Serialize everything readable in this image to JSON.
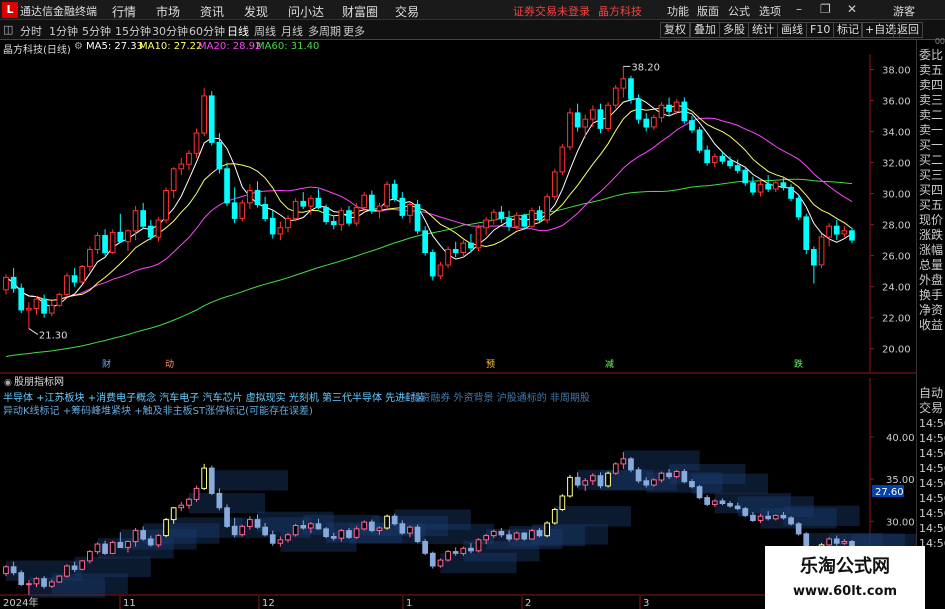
{
  "menubar": {
    "logo": "L",
    "app_title": "通达信金融终端",
    "items": [
      "行情",
      "市场",
      "资讯",
      "发现",
      "问小达",
      "财富圈",
      "交易"
    ],
    "notice": "证券交易未登录",
    "notice_stock": "晶方科技",
    "right_items": [
      "功能",
      "版面",
      "公式",
      "选项"
    ],
    "guest": "游客"
  },
  "toolbar": {
    "periods": [
      "分时",
      "1分钟",
      "5分钟",
      "15分钟",
      "30分钟",
      "60分钟",
      "日线",
      "周线",
      "月线",
      "多周期",
      "更多"
    ],
    "active_period": "日线",
    "right_buttons": [
      "复权",
      "叠加",
      "多股",
      "统计",
      "画线",
      "F10",
      "标记",
      "+自选",
      "返回"
    ]
  },
  "info": {
    "stock": "晶方科技(日线)",
    "ma5_label": "MA5: 27.33",
    "ma10_label": "MA10: 27.22",
    "ma20_label": "MA20: 28.92",
    "ma60_label": "MA60: 31.40",
    "colors": {
      "ma5": "#ffffff",
      "ma10": "#ffff66",
      "ma20": "#ff44ff",
      "ma60": "#44dd44"
    }
  },
  "indicator": {
    "title": "股朋指标网",
    "concept_line": "半导体 +江苏板块 +消费电子概念 汽车电子 汽车芯片 虚拟现实 光刻机 第三代半导体 先进封装",
    "concept_line_dim": "+融资融券 外资背景 沪股通标的 非周期股",
    "note_line": "异动K线标记 +筹码峰堆紧块 +触及非主板ST涨停标记(可能存在误差)"
  },
  "sidebar": {
    "items": [
      "委比",
      "卖五",
      "卖四",
      "卖三",
      "卖二",
      "卖一",
      "买一",
      "买二",
      "买三",
      "买四",
      "买五",
      "现价",
      "涨跌",
      "涨幅",
      "总量",
      "外盘",
      "换手",
      "净资",
      "收益"
    ],
    "lower_items": [
      "自动",
      "交易",
      "14:56",
      "14:56",
      "14:56",
      "14:56",
      "14:56",
      "14:56",
      "14:56",
      "14:56",
      "14:56"
    ],
    "top_tag": "00"
  },
  "watermark": {
    "line1": "乐淘公式网",
    "line2": "www.60lt.com"
  },
  "chart_data": [
    {
      "type": "candlestick",
      "title": "晶方科技(日线)",
      "ylim": [
        18.5,
        39.0
      ],
      "y_ticks": [
        20.0,
        22.0,
        24.0,
        26.0,
        28.0,
        30.0,
        32.0,
        34.0,
        36.0,
        38.0
      ],
      "x_labels": [
        "2024年",
        "11",
        "12",
        "1",
        "2",
        "3",
        "4"
      ],
      "annotations": {
        "high": "38.20",
        "low": "21.30"
      },
      "event_markers": [
        "财",
        "动",
        "预",
        "减",
        "跌"
      ],
      "up_color": "#ff3333",
      "down_color": "#00ffff",
      "grid": false,
      "candles": [
        [
          23.8,
          24.8,
          23.5,
          24.6
        ],
        [
          24.6,
          25.2,
          23.6,
          23.9
        ],
        [
          23.9,
          24.2,
          22.3,
          22.5
        ],
        [
          22.5,
          23.0,
          21.3,
          22.6
        ],
        [
          22.6,
          23.4,
          22.2,
          23.2
        ],
        [
          23.2,
          23.5,
          22.0,
          22.3
        ],
        [
          22.3,
          23.1,
          22.1,
          22.8
        ],
        [
          22.8,
          23.6,
          22.7,
          23.5
        ],
        [
          23.5,
          24.9,
          23.3,
          24.7
        ],
        [
          24.7,
          25.2,
          24.0,
          24.3
        ],
        [
          24.3,
          25.4,
          24.2,
          25.3
        ],
        [
          25.3,
          26.6,
          25.0,
          26.4
        ],
        [
          26.4,
          27.5,
          26.1,
          27.3
        ],
        [
          27.3,
          27.7,
          26.0,
          26.2
        ],
        [
          26.2,
          27.7,
          26.1,
          27.5
        ],
        [
          27.5,
          28.7,
          27.0,
          26.9
        ],
        [
          26.9,
          27.7,
          26.3,
          27.6
        ],
        [
          27.6,
          29.2,
          27.0,
          28.9
        ],
        [
          28.9,
          29.4,
          27.7,
          27.9
        ],
        [
          27.9,
          28.3,
          27.0,
          27.2
        ],
        [
          27.2,
          28.5,
          26.9,
          28.3
        ],
        [
          28.3,
          30.4,
          28.1,
          30.2
        ],
        [
          30.2,
          31.7,
          29.7,
          31.6
        ],
        [
          31.6,
          32.3,
          31.2,
          31.9
        ],
        [
          31.9,
          32.8,
          31.5,
          32.6
        ],
        [
          32.6,
          34.2,
          32.3,
          33.9
        ],
        [
          33.9,
          36.8,
          33.7,
          36.3
        ],
        [
          36.3,
          36.6,
          33.1,
          33.3
        ],
        [
          33.3,
          33.9,
          31.3,
          31.6
        ],
        [
          31.6,
          32.0,
          29.2,
          29.4
        ],
        [
          29.4,
          30.4,
          28.1,
          28.4
        ],
        [
          28.4,
          29.6,
          28.2,
          29.4
        ],
        [
          29.4,
          30.6,
          29.0,
          30.2
        ],
        [
          30.2,
          30.8,
          29.1,
          29.3
        ],
        [
          29.3,
          29.8,
          28.2,
          28.4
        ],
        [
          28.4,
          28.9,
          27.1,
          27.4
        ],
        [
          27.4,
          28.2,
          27.0,
          27.8
        ],
        [
          27.8,
          28.6,
          27.5,
          28.4
        ],
        [
          28.4,
          29.7,
          28.2,
          29.5
        ],
        [
          29.5,
          30.1,
          29.0,
          29.2
        ],
        [
          29.2,
          29.9,
          28.6,
          29.7
        ],
        [
          29.7,
          30.3,
          29.0,
          29.1
        ],
        [
          29.1,
          29.3,
          28.0,
          28.2
        ],
        [
          28.2,
          28.6,
          27.7,
          28.0
        ],
        [
          28.0,
          29.1,
          27.6,
          28.9
        ],
        [
          28.9,
          29.2,
          27.9,
          28.1
        ],
        [
          28.1,
          29.4,
          27.9,
          29.1
        ],
        [
          29.1,
          30.1,
          28.9,
          29.9
        ],
        [
          29.9,
          30.2,
          28.7,
          28.9
        ],
        [
          28.9,
          29.4,
          28.4,
          29.2
        ],
        [
          29.2,
          30.8,
          29.0,
          30.6
        ],
        [
          30.6,
          30.9,
          29.5,
          29.7
        ],
        [
          29.7,
          30.1,
          28.4,
          28.6
        ],
        [
          28.6,
          29.5,
          28.1,
          29.3
        ],
        [
          29.3,
          29.6,
          27.4,
          27.6
        ],
        [
          27.6,
          27.9,
          26.0,
          26.2
        ],
        [
          26.2,
          26.4,
          24.4,
          24.7
        ],
        [
          24.7,
          25.6,
          24.5,
          25.4
        ],
        [
          25.4,
          26.6,
          25.2,
          26.4
        ],
        [
          26.4,
          26.9,
          25.9,
          26.2
        ],
        [
          26.2,
          27.0,
          25.9,
          26.8
        ],
        [
          26.8,
          27.4,
          26.2,
          26.5
        ],
        [
          26.5,
          28.0,
          26.3,
          27.8
        ],
        [
          27.8,
          28.5,
          27.3,
          28.3
        ],
        [
          28.3,
          29.0,
          28.0,
          28.8
        ],
        [
          28.8,
          29.2,
          28.1,
          28.4
        ],
        [
          28.4,
          28.9,
          27.6,
          27.9
        ],
        [
          27.9,
          28.8,
          27.7,
          28.6
        ],
        [
          28.6,
          28.7,
          27.7,
          27.9
        ],
        [
          27.9,
          29.1,
          27.8,
          28.9
        ],
        [
          28.9,
          29.2,
          28.1,
          28.3
        ],
        [
          28.3,
          30.0,
          28.1,
          29.8
        ],
        [
          29.8,
          31.6,
          29.6,
          31.4
        ],
        [
          31.4,
          33.2,
          31.2,
          33.0
        ],
        [
          33.0,
          35.5,
          32.8,
          35.2
        ],
        [
          35.2,
          35.8,
          34.0,
          34.3
        ],
        [
          34.3,
          35.1,
          33.6,
          34.8
        ],
        [
          34.8,
          35.7,
          34.3,
          35.4
        ],
        [
          35.4,
          35.8,
          33.9,
          34.2
        ],
        [
          34.2,
          35.9,
          34.0,
          35.7
        ],
        [
          35.7,
          37.0,
          35.5,
          36.8
        ],
        [
          36.8,
          38.2,
          36.2,
          37.4
        ],
        [
          37.4,
          37.6,
          35.8,
          36.1
        ],
        [
          36.1,
          36.4,
          34.5,
          34.8
        ],
        [
          34.8,
          35.2,
          34.0,
          34.3
        ],
        [
          34.3,
          35.1,
          34.1,
          34.9
        ],
        [
          34.9,
          35.9,
          34.6,
          35.7
        ],
        [
          35.7,
          36.2,
          35.0,
          35.3
        ],
        [
          35.3,
          36.1,
          35.1,
          35.9
        ],
        [
          35.9,
          36.2,
          34.5,
          34.7
        ],
        [
          34.7,
          35.0,
          33.9,
          34.1
        ],
        [
          34.1,
          34.3,
          32.6,
          32.8
        ],
        [
          32.8,
          33.1,
          31.8,
          32.0
        ],
        [
          32.0,
          32.6,
          31.7,
          32.4
        ],
        [
          32.4,
          32.7,
          31.9,
          32.1
        ],
        [
          32.1,
          32.4,
          31.6,
          31.8
        ],
        [
          31.8,
          32.2,
          31.3,
          31.5
        ],
        [
          31.5,
          31.7,
          30.5,
          30.7
        ],
        [
          30.7,
          31.1,
          29.9,
          30.1
        ],
        [
          30.1,
          30.9,
          29.8,
          30.6
        ],
        [
          30.6,
          31.2,
          30.1,
          30.3
        ],
        [
          30.3,
          30.8,
          30.1,
          30.7
        ],
        [
          30.7,
          31.1,
          30.2,
          30.4
        ],
        [
          30.4,
          30.6,
          29.5,
          29.7
        ],
        [
          29.7,
          29.9,
          28.3,
          28.5
        ],
        [
          28.5,
          28.7,
          26.1,
          26.4
        ],
        [
          26.4,
          26.6,
          24.2,
          25.4
        ],
        [
          25.4,
          27.4,
          25.2,
          27.2
        ],
        [
          27.2,
          28.1,
          26.6,
          27.9
        ],
        [
          27.9,
          28.3,
          27.0,
          27.4
        ],
        [
          27.4,
          27.9,
          27.2,
          27.6
        ],
        [
          27.6,
          27.8,
          26.8,
          27.0
        ]
      ]
    },
    {
      "type": "candlestick",
      "title": "股朋指标网",
      "ylim": [
        21.5,
        42.0
      ],
      "y_ticks": [
        25.0,
        30.0,
        35.0,
        40.0
      ],
      "last_value_label": "27.60",
      "up_color": "#ff6699",
      "down_color": "#88aadd",
      "highlight_color": "#ffff88"
    }
  ]
}
